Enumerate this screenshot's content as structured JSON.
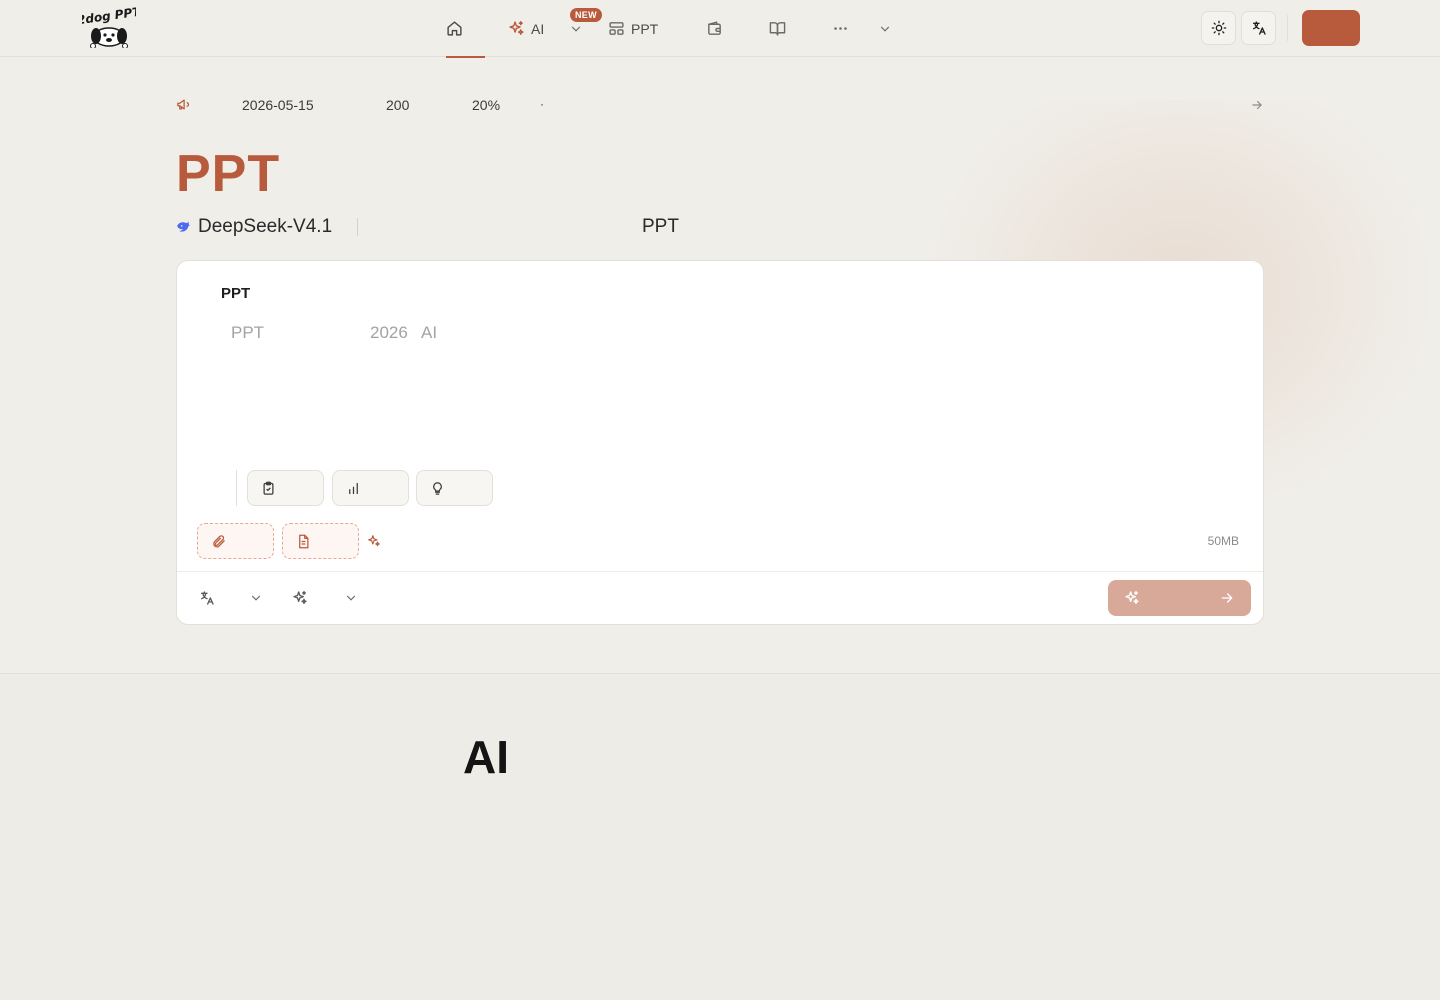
{
  "nav": {
    "brand": "2dog PPT",
    "items": [
      {
        "id": "home",
        "label": "",
        "icon": "home-icon",
        "active": true
      },
      {
        "id": "ai",
        "label": "AI",
        "icon": "sparkles-icon"
      },
      {
        "id": "ppt",
        "label": "PPT",
        "icon": "layout-icon"
      },
      {
        "id": "wallet",
        "label": "",
        "icon": "wallet-icon"
      },
      {
        "id": "book",
        "label": "",
        "icon": "book-icon"
      },
      {
        "id": "more",
        "label": "",
        "icon": "more-icon"
      }
    ],
    "badge": "NEW",
    "theme_icon": "sun-icon",
    "language_icon": "translate-icon",
    "login_label": "",
    "accent": "#b85a3c"
  },
  "announcement": {
    "icon": "megaphone-icon",
    "date": "2026-05-15",
    "count": "200",
    "percent": "20%",
    "dot": "·",
    "arrow_icon": "arrow-right-icon"
  },
  "hero": {
    "title": "PPT",
    "model_icon": "deepseek-whale-icon",
    "model_name": "DeepSeek-V4.1",
    "tagline": "PPT"
  },
  "composer": {
    "label": "PPT",
    "placeholder_1": "PPT",
    "placeholder_2": "2026",
    "placeholder_3": "AI",
    "chips": [
      {
        "icon": "clipboard-check-icon",
        "label": ""
      },
      {
        "icon": "bar-chart-icon",
        "label": ""
      },
      {
        "icon": "lightbulb-icon",
        "label": ""
      }
    ],
    "attachments": [
      {
        "icon": "paperclip-icon",
        "label": ""
      },
      {
        "icon": "document-icon",
        "label": ""
      }
    ],
    "size_note": "50MB",
    "language_select": {
      "icon": "translate-icon",
      "value": ""
    },
    "style_select": {
      "icon": "sparkles-icon",
      "value": ""
    },
    "generate_label": "",
    "generate_color": "#d8a999"
  },
  "section": {
    "title": "AI"
  }
}
